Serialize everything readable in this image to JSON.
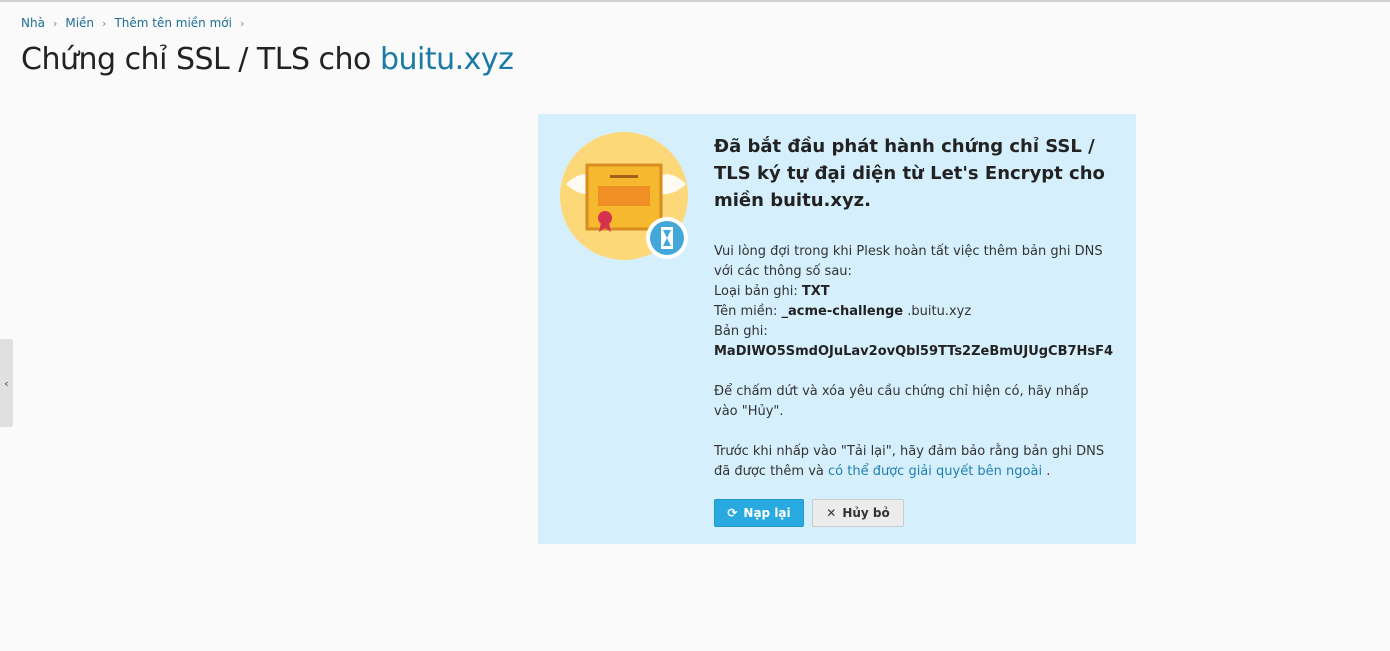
{
  "breadcrumb": {
    "items": [
      "Nhà",
      "Miền",
      "Thêm tên miền mới"
    ]
  },
  "page": {
    "title_prefix": "Chứng chỉ SSL / TLS cho",
    "title_domain": "buitu.xyz"
  },
  "side_toggle": {
    "icon": "‹"
  },
  "panel": {
    "heading": "Đã bắt đầu phát hành chứng chỉ SSL / TLS ký tự đại diện từ Let's Encrypt cho miền buitu.xyz.",
    "intro": "Vui lòng đợi trong khi Plesk hoàn tất việc thêm bản ghi DNS với các thông số sau:",
    "record_type_label": "Loại bản ghi:",
    "record_type_value": "TXT",
    "domain_label": "Tên miền:",
    "domain_value_bold": "_acme-challenge",
    "domain_value_rest": ".buitu.xyz",
    "record_label": "Bản ghi:",
    "record_value": "MaDIWO5SmdOJuLav2ovQbl59TTs2ZeBmUJUgCB7HsF4",
    "cancel_note": "Để chấm dứt và xóa yêu cầu chứng chỉ hiện có, hãy nhấp vào \"Hủy\".",
    "reload_note_prefix": "Trước khi nhấp vào \"Tải lại\", hãy đảm bảo rằng bản ghi DNS đã được thêm và",
    "reload_note_link": "có thể được giải quyết bên ngoài",
    "reload_note_suffix": "."
  },
  "buttons": {
    "reload_label": "Nạp lại",
    "cancel_label": "Hủy bỏ"
  },
  "colors": {
    "accent": "#28a9e0",
    "panel_bg": "#d5f0fc",
    "link": "#1f7fb0",
    "certificate": "#f5b82e"
  }
}
